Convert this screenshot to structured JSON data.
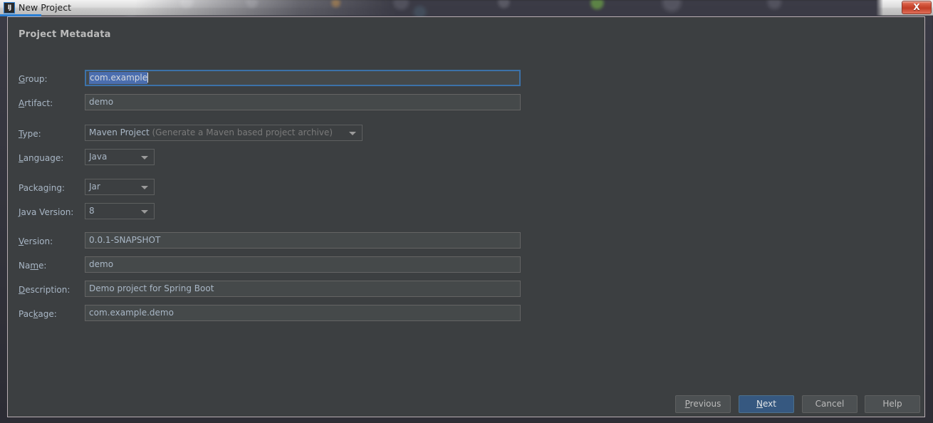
{
  "window": {
    "title": "New Project",
    "icon": "intellij-idea-icon",
    "icon_glyph": "IJ",
    "close_label": "X"
  },
  "dialog": {
    "heading": "Project Metadata",
    "background_color": "#3c3f41",
    "accent_color": "#365880"
  },
  "fields": {
    "group": {
      "label_pre": "",
      "label_mnemonic": "G",
      "label_post": "roup:",
      "value": "com.example",
      "selected": true
    },
    "artifact": {
      "label_pre": "",
      "label_mnemonic": "A",
      "label_post": "rtifact:",
      "value": "demo"
    },
    "type": {
      "label_pre": "",
      "label_mnemonic": "T",
      "label_post": "ype:",
      "value": "Maven Project",
      "value_hint": "(Generate a Maven based project archive)"
    },
    "language": {
      "label_pre": "",
      "label_mnemonic": "L",
      "label_post": "anguage:",
      "value": "Java"
    },
    "packaging": {
      "label_pre": "Packa",
      "label_mnemonic": "g",
      "label_post": "ing:",
      "value": "Jar"
    },
    "java_version": {
      "label_pre": "",
      "label_mnemonic": "J",
      "label_post": "ava Version:",
      "value": "8"
    },
    "version": {
      "label_pre": "",
      "label_mnemonic": "V",
      "label_post": "ersion:",
      "value": "0.0.1-SNAPSHOT"
    },
    "name": {
      "label_pre": "Na",
      "label_mnemonic": "m",
      "label_post": "e:",
      "value": "demo"
    },
    "description": {
      "label_pre": "",
      "label_mnemonic": "D",
      "label_post": "escription:",
      "value": "Demo project for Spring Boot"
    },
    "package": {
      "label_pre": "Pac",
      "label_mnemonic": "k",
      "label_post": "age:",
      "value": "com.example.demo"
    }
  },
  "buttons": {
    "previous": {
      "pre": "",
      "mnemonic": "P",
      "post": "revious"
    },
    "next": {
      "pre": "",
      "mnemonic": "N",
      "post": "ext",
      "is_default": true
    },
    "cancel": {
      "pre": "Cancel",
      "mnemonic": "",
      "post": ""
    },
    "help": {
      "pre": "Help",
      "mnemonic": "",
      "post": ""
    }
  }
}
